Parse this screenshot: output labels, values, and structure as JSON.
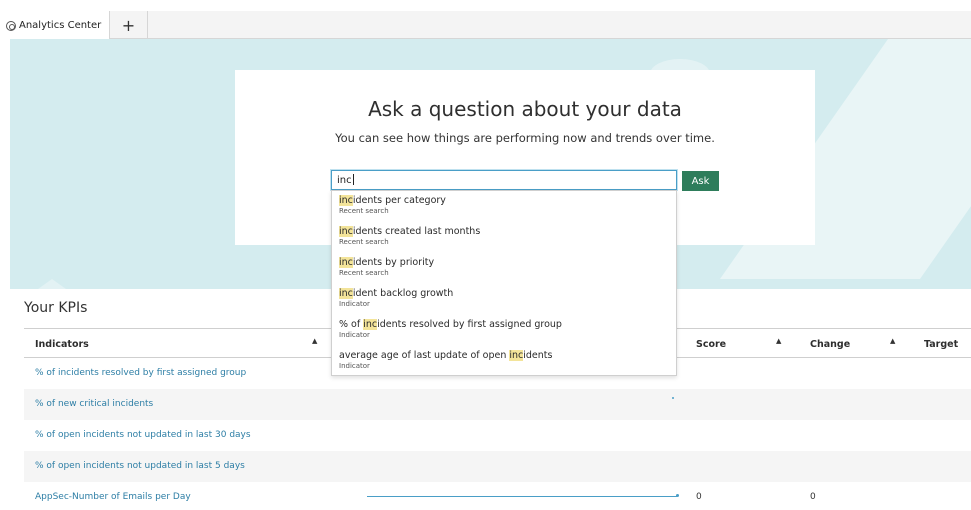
{
  "tabs": {
    "active_label": "Analytics Center",
    "add_label": "+"
  },
  "hero": {
    "title": "Ask a question about your data",
    "subtitle": "You can see how things are performing now and trends over time.",
    "search_value": "inc",
    "ask_label": "Ask"
  },
  "suggestions": [
    {
      "match": "inc",
      "rest": "idents per category",
      "type": "Recent search"
    },
    {
      "match": "inc",
      "rest": "idents created last months",
      "type": "Recent search"
    },
    {
      "match": "inc",
      "rest": "idents by priority",
      "type": "Recent search"
    },
    {
      "match": "inc",
      "rest": "ident backlog growth",
      "type": "Indicator"
    },
    {
      "before": "% of ",
      "match": "inc",
      "rest": "idents resolved by first assigned group",
      "type": "Indicator"
    },
    {
      "before": "average age of last update of open ",
      "match": "inc",
      "rest": "idents",
      "type": "Indicator"
    }
  ],
  "kpis": {
    "title": "Your KPIs",
    "columns": {
      "indicators": "Indicators",
      "score": "Score",
      "change": "Change",
      "target": "Target"
    },
    "sort_glyph": "▲",
    "rows": [
      {
        "indicator": "% of incidents resolved by first assigned group",
        "score": "",
        "change": ""
      },
      {
        "indicator": "% of new critical incidents",
        "score": "",
        "change": ""
      },
      {
        "indicator": "% of open incidents not updated in last 30 days",
        "score": "",
        "change": ""
      },
      {
        "indicator": "% of open incidents not updated in last 5 days",
        "score": "",
        "change": ""
      },
      {
        "indicator": "AppSec-Number of Emails per Day",
        "score": "0",
        "change": "0"
      }
    ]
  },
  "colors": {
    "hero_bg": "#d4ecef",
    "ask_button": "#2e7d5b",
    "link": "#2d7ea5",
    "highlight": "#f3e49a"
  },
  "icons": {
    "tab_icon": "analytics-logo-icon",
    "sort": "sort-ascending-icon"
  }
}
